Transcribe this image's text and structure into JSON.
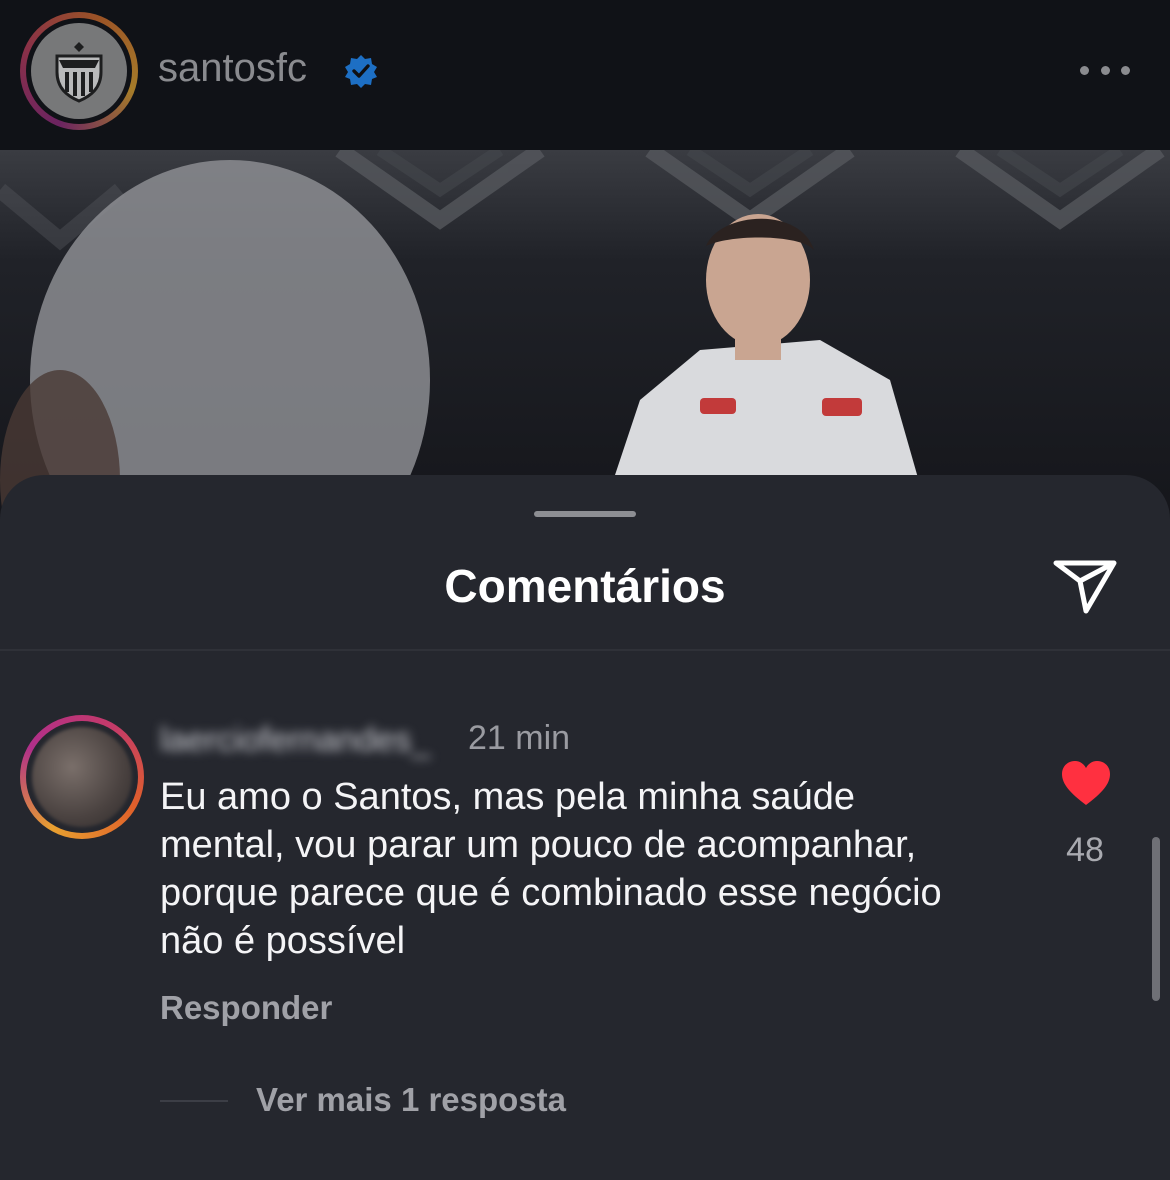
{
  "post": {
    "username": "santosfc",
    "avatar_icon": "santos-fc-crest-icon",
    "verified_icon": "verified-badge-icon",
    "more_icon": "more-options-icon"
  },
  "comments_sheet": {
    "title": "Comentários",
    "share_icon": "send-paper-plane-icon"
  },
  "comment": {
    "username": "laerciofernandes_",
    "time": "21 min",
    "text": "Eu amo o Santos, mas pela minha saúde mental, vou parar um pouco de acompanhar, porque parece que é combinado esse negócio não é possível",
    "like_icon": "heart-filled-icon",
    "like_count": "48",
    "reply_label": "Responder",
    "more_replies_label": "Ver mais 1 resposta"
  },
  "colors": {
    "sheet_bg": "#25272e",
    "like_red": "#ff3040",
    "verified_blue": "#1d6fc4"
  }
}
